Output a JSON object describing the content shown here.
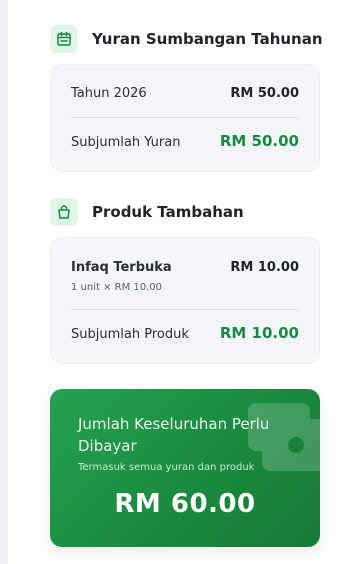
{
  "fees_section": {
    "title": "Yuran Sumbangan Tahunan",
    "icon": "calendar-icon",
    "rows": [
      {
        "label": "Tahun 2026",
        "amount": "RM 50.00"
      }
    ],
    "subtotal_label": "Subjumlah Yuran",
    "subtotal_amount": "RM 50.00"
  },
  "products_section": {
    "title": "Produk Tambahan",
    "icon": "shopping-bag-icon",
    "items": [
      {
        "name": "Infaq Terbuka",
        "detail": "1 unit × RM 10.00",
        "amount": "RM 10.00"
      }
    ],
    "subtotal_label": "Subjumlah Produk",
    "subtotal_amount": "RM 10.00"
  },
  "total": {
    "title": "Jumlah Keseluruhan Perlu Dibayar",
    "note": "Termasuk semua yuran dan produk",
    "amount": "RM 60.00"
  },
  "colors": {
    "accent_green": "#1a8a44",
    "icon_bg": "#dff5e6",
    "card_bg": "#f5f6f9"
  }
}
